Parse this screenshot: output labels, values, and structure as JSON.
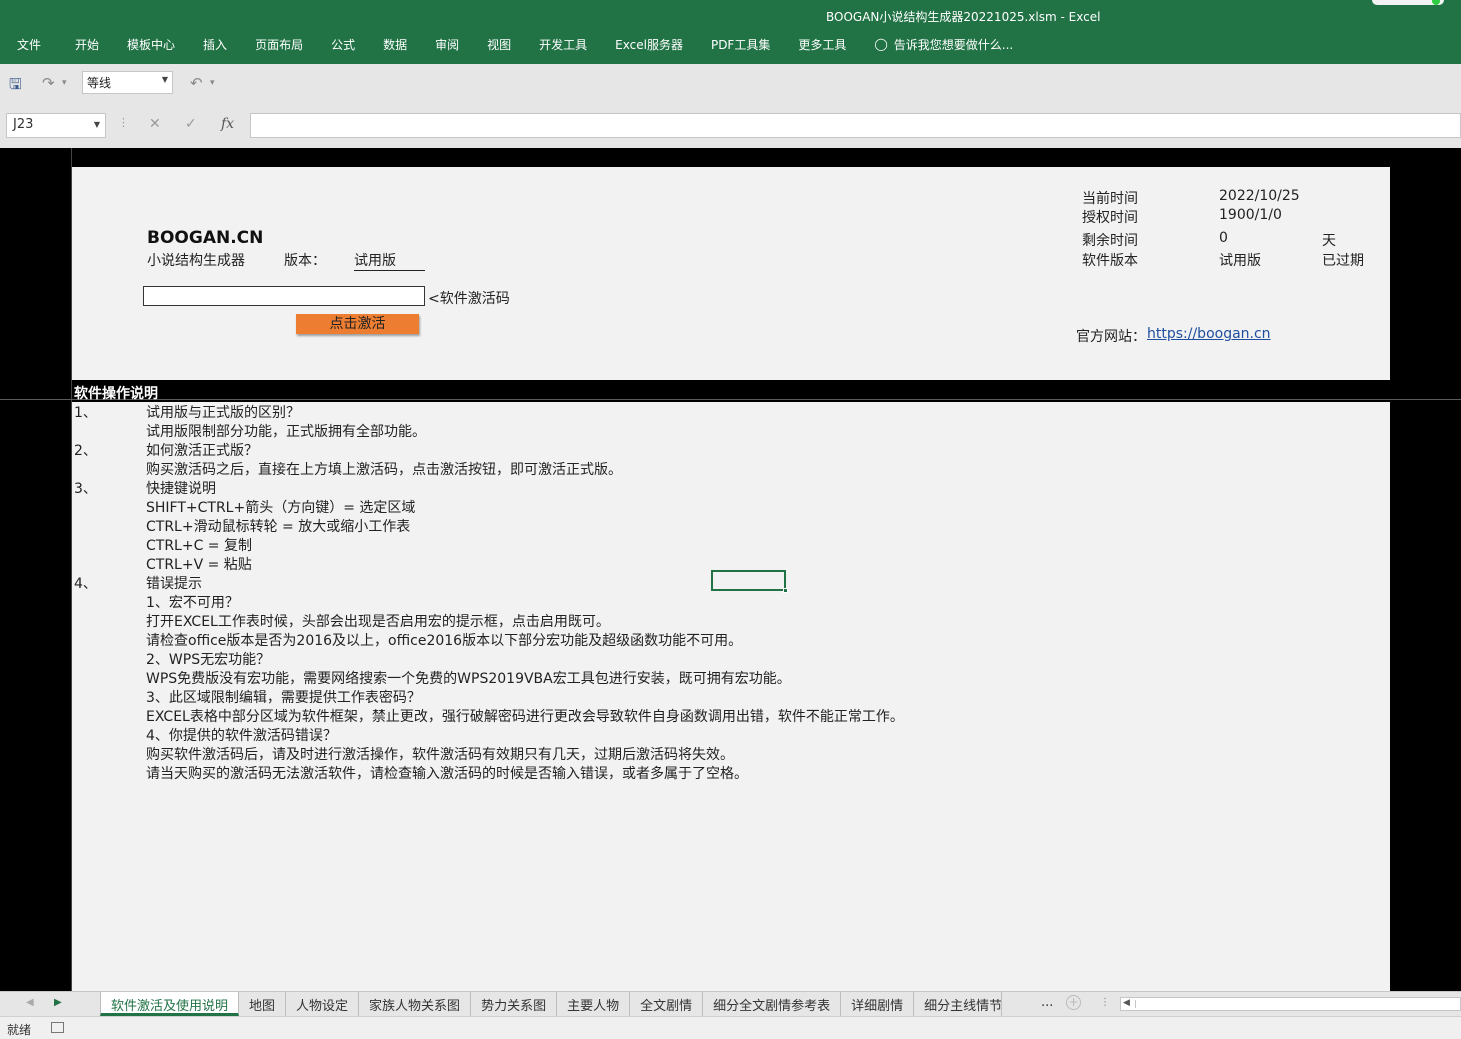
{
  "window": {
    "title": "BOOGAN小说结构生成器20221025.xlsm - Excel"
  },
  "menu": [
    "文件",
    "开始",
    "模板中心",
    "插入",
    "页面布局",
    "公式",
    "数据",
    "审阅",
    "视图",
    "开发工具",
    "Excel服务器",
    "PDF工具集",
    "更多工具"
  ],
  "tell_me": "告诉我您想要做什么...",
  "toolbar": {
    "font_name": "等线"
  },
  "formula_bar": {
    "name_box": "J23",
    "formula": ""
  },
  "sheet": {
    "brand": "BOOGAN.CN",
    "product_name": "小说结构生成器",
    "version_label": "版本：",
    "version_value": "试用版",
    "activation_code_label": "<软件激活码",
    "activation_code_value": "",
    "activate_button": "点击激活",
    "info": {
      "current_time_label": "当前时间",
      "current_time_value": "2022/10/25",
      "auth_time_label": "授权时间",
      "auth_time_value": "1900/1/0",
      "remaining_label": "剩余时间",
      "remaining_value": "0",
      "remaining_unit": "天",
      "software_version_label": "软件版本",
      "software_version_value": "试用版",
      "status": "已过期"
    },
    "website_label": "官方网站：",
    "website_url": "https://boogan.cn",
    "instructions_header": "软件操作说明",
    "instructions": [
      {
        "num": "1、",
        "text": "试用版与正式版的区别？"
      },
      {
        "num": "",
        "text": "试用版限制部分功能，正式版拥有全部功能。"
      },
      {
        "num": "2、",
        "text": "如何激活正式版？"
      },
      {
        "num": "",
        "text": "购买激活码之后，直接在上方填上激活码，点击激活按钮，即可激活正式版。"
      },
      {
        "num": "3、",
        "text": "快捷键说明"
      },
      {
        "num": "",
        "text": "SHIFT+CTRL+箭头（方向键）= 选定区域"
      },
      {
        "num": "",
        "text": "CTRL+滑动鼠标转轮 = 放大或缩小工作表"
      },
      {
        "num": "",
        "text": "CTRL+C = 复制"
      },
      {
        "num": "",
        "text": "CTRL+V = 粘贴"
      },
      {
        "num": "4、",
        "text": "错误提示"
      },
      {
        "num": "",
        "text": "1、宏不可用？"
      },
      {
        "num": "",
        "text": "打开EXCEL工作表时候，头部会出现是否启用宏的提示框，点击启用既可。"
      },
      {
        "num": "",
        "text": "请检查office版本是否为2016及以上，office2016版本以下部分宏功能及超级函数功能不可用。"
      },
      {
        "num": "",
        "text": "2、WPS无宏功能？"
      },
      {
        "num": "",
        "text": "WPS免费版没有宏功能，需要网络搜索一个免费的WPS2019VBA宏工具包进行安装，既可拥有宏功能。"
      },
      {
        "num": "",
        "text": "3、此区域限制编辑，需要提供工作表密码？"
      },
      {
        "num": "",
        "text": "EXCEL表格中部分区域为软件框架，禁止更改，强行破解密码进行更改会导致软件自身函数调用出错，软件不能正常工作。"
      },
      {
        "num": "",
        "text": "4、你提供的软件激活码错误？"
      },
      {
        "num": "",
        "text": "购买软件激活码后，请及时进行激活操作，软件激活码有效期只有几天，过期后激活码将失效。"
      },
      {
        "num": "",
        "text": "请当天购买的激活码无法激活软件，请检查输入激活码的时候是否输入错误，或者多属于了空格。"
      }
    ]
  },
  "tabs": [
    "软件激活及使用说明",
    "地图",
    "人物设定",
    "家族人物关系图",
    "势力关系图",
    "主要人物",
    "全文剧情",
    "细分全文剧情参考表",
    "详细剧情",
    "细分主线情节"
  ],
  "tab_overflow": "...",
  "status": {
    "ready": "就绪"
  },
  "colors": {
    "ribbon": "#217346",
    "button": "#ed7d31",
    "link": "#1f4e9e"
  }
}
